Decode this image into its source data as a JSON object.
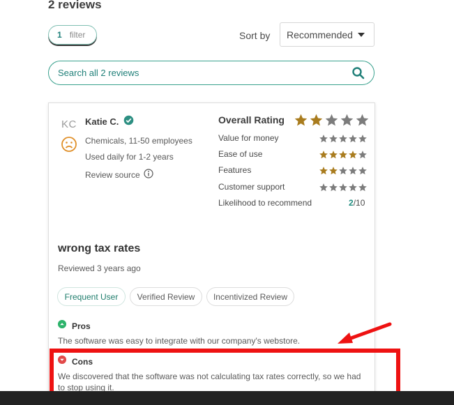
{
  "header": {
    "reviews_count": "2 reviews"
  },
  "filter": {
    "count": "1",
    "label": "filter"
  },
  "sort": {
    "label": "Sort by",
    "selected": "Recommended"
  },
  "search": {
    "placeholder": "Search all 2 reviews"
  },
  "review": {
    "initials": "KC",
    "name": "Katie C.",
    "company": "Chemicals, 11-50 employees",
    "usage": "Used daily for 1-2 years",
    "source": "Review source",
    "overall_label": "Overall Rating",
    "overall_stars": 2,
    "ratings": [
      {
        "label": "Value for money",
        "stars": 0
      },
      {
        "label": "Ease of use",
        "stars": 4
      },
      {
        "label": "Features",
        "stars": 2
      },
      {
        "label": "Customer support",
        "stars": 0
      }
    ],
    "recommend_label": "Likelihood to recommend",
    "recommend_score": "2",
    "recommend_total": "/10",
    "title": "wrong tax rates",
    "reviewed": "Reviewed 3 years ago",
    "tags": [
      "Frequent User",
      "Verified Review",
      "Incentivized Review"
    ],
    "pros_label": "Pros",
    "pros_text": "The software was easy to integrate with our company's webstore.",
    "cons_label": "Cons",
    "cons_text_1": "We discovered that the software was not calculating tax rates correctly, so we had",
    "cons_text_2": "to stop using it."
  },
  "colors": {
    "accent": "#1e7f7a",
    "star_filled": "#a97c1e",
    "star_empty": "#7c7c7c",
    "highlight": "#ee1212"
  }
}
